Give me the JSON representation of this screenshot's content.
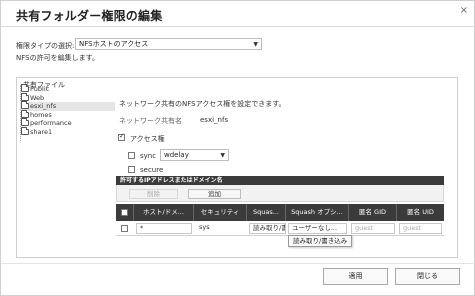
{
  "dialog": {
    "title": "共有フォルダー権限の編集",
    "close_glyph": "×"
  },
  "permission_type": {
    "label": "権限タイプの選択:",
    "selected": "NFSホストのアクセス",
    "note": "NFSの許可を編集します。"
  },
  "shared_files": {
    "group_label": "共有ファイル",
    "folders": [
      "Public",
      "Web",
      "esxi_nfs",
      "homes",
      "performance",
      "share1"
    ],
    "selected_folder": "esxi_nfs"
  },
  "nfs": {
    "description": "ネットワーク共有のNFSアクセス権を設定できます。",
    "share_name_label": "ネットワーク共有名",
    "share_name_value": "esxi_nfs",
    "access_label": "アクセス権",
    "access_checked": true,
    "sync_label": "sync",
    "sync_checked": false,
    "sync_option": "wdelay",
    "secure_label": "secure",
    "secure_checked": false
  },
  "ip_section": {
    "title": "許可するIPアドレスまたはドメイン名",
    "delete_label": "削除",
    "add_label": "追加"
  },
  "table": {
    "headers": [
      "ホスト/ドメ...",
      "セキュリティ",
      "Squas...",
      "Squash オプシ...",
      "匿名 GID",
      "匿名 UID"
    ],
    "row": {
      "host": "*",
      "security": "sys",
      "squash": "読み取り/書",
      "squash_option": "ユーザーなし...",
      "gid": "guest",
      "uid": "guest"
    },
    "tooltip": "読み取り/書き込み"
  },
  "footer": {
    "apply_label": "適用",
    "close_label": "閉じる"
  }
}
